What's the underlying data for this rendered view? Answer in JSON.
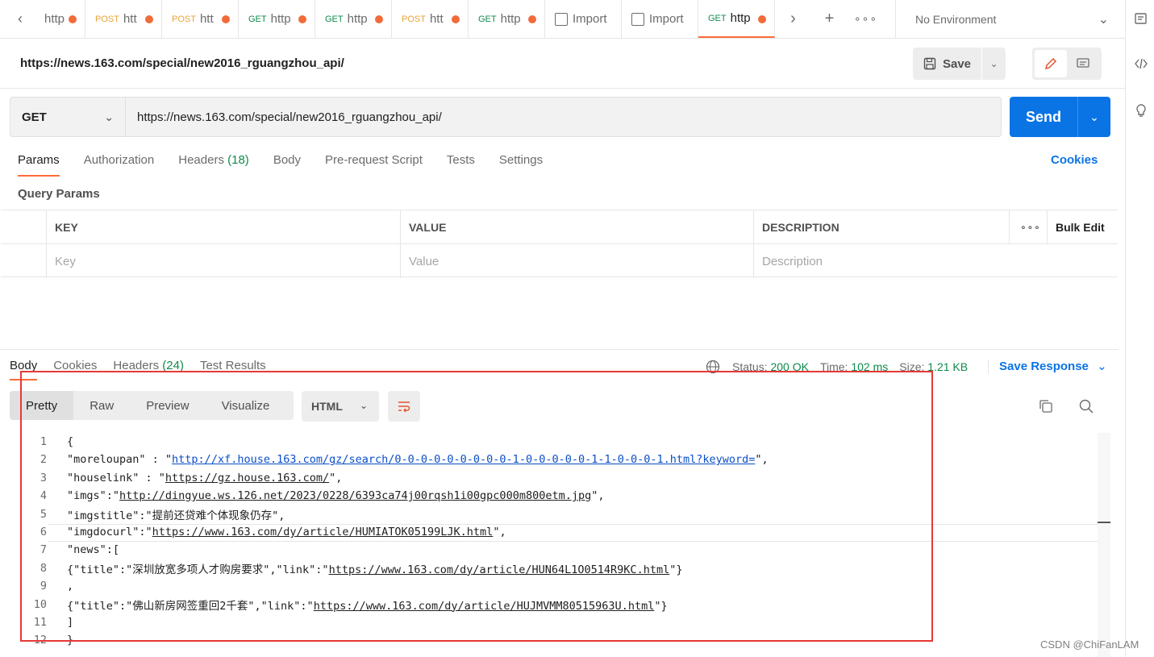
{
  "tabs": [
    {
      "method": "",
      "label": "http"
    },
    {
      "method": "POST",
      "label": "htt"
    },
    {
      "method": "POST",
      "label": "htt"
    },
    {
      "method": "GET",
      "label": "http"
    },
    {
      "method": "GET",
      "label": "http"
    },
    {
      "method": "POST",
      "label": "htt"
    },
    {
      "method": "GET",
      "label": "http"
    },
    {
      "method": "",
      "label": "Import"
    },
    {
      "method": "",
      "label": "Import"
    },
    {
      "method": "GET",
      "label": "http"
    }
  ],
  "environment": {
    "label": "No Environment"
  },
  "request": {
    "title": "https://news.163.com/special/new2016_rguangzhou_api/",
    "method": "GET",
    "url": "https://news.163.com/special/new2016_rguangzhou_api/",
    "save_label": "Save",
    "send_label": "Send"
  },
  "request_tabs": {
    "params": "Params",
    "authorization": "Authorization",
    "headers": "Headers",
    "headers_count": "(18)",
    "body": "Body",
    "prerequest": "Pre-request Script",
    "tests": "Tests",
    "settings": "Settings",
    "cookies": "Cookies"
  },
  "query_params": {
    "title": "Query Params",
    "columns": {
      "key": "KEY",
      "value": "VALUE",
      "description": "DESCRIPTION",
      "bulk_edit": "Bulk Edit"
    },
    "placeholders": {
      "key": "Key",
      "value": "Value",
      "description": "Description"
    }
  },
  "response": {
    "tabs": {
      "body": "Body",
      "cookies": "Cookies",
      "headers": "Headers",
      "headers_count": "(24)",
      "tests": "Test Results"
    },
    "status_label": "Status:",
    "status_value": "200 OK",
    "time_label": "Time:",
    "time_value": "102 ms",
    "size_label": "Size:",
    "size_value": "1.21 KB",
    "save_response": "Save Response",
    "views": {
      "pretty": "Pretty",
      "raw": "Raw",
      "preview": "Preview",
      "visualize": "Visualize"
    },
    "format": "HTML"
  },
  "code_lines": [
    {
      "n": "1",
      "pre": "{",
      "url": "",
      "post": ""
    },
    {
      "n": "2",
      "pre": "\"moreloupan\" : \"",
      "url": "http://xf.house.163.com/gz/search/0-0-0-0-0-0-0-0-0-1-0-0-0-0-0-1-1-0-0-0-1.html?keyword=",
      "post": "\",",
      "blue": true
    },
    {
      "n": "3",
      "pre": "\"houselink\" : \"",
      "url": "https://gz.house.163.com/",
      "post": "\","
    },
    {
      "n": "4",
      "pre": "\"imgs\":\"",
      "url": "http://dingyue.ws.126.net/2023/0228/6393ca74j00rqsh1i00gpc000m800etm.jpg",
      "post": "\","
    },
    {
      "n": "5",
      "pre": "\"imgstitle\":\"提前还贷难个体现象仍存\",",
      "url": "",
      "post": ""
    },
    {
      "n": "6",
      "pre": "\"imgdocurl\":\"",
      "url": "https://www.163.com/dy/article/HUMIATOK05199LJK.html",
      "post": "\","
    },
    {
      "n": "7",
      "pre": "\"news\":[",
      "url": "",
      "post": ""
    },
    {
      "n": "8",
      "pre": "{\"title\":\"深圳放宽多项人才购房要求\",\"link\":\"",
      "url": "https://www.163.com/dy/article/HUN64L1O0514R9KC.html",
      "post": "\"}"
    },
    {
      "n": "9",
      "pre": ",",
      "url": "",
      "post": ""
    },
    {
      "n": "10",
      "pre": "{\"title\":\"佛山新房网签重回2千套\",\"link\":\"",
      "url": "https://www.163.com/dy/article/HUJMVMM80515963U.html",
      "post": "\"}"
    },
    {
      "n": "11",
      "pre": "]",
      "url": "",
      "post": ""
    },
    {
      "n": "12",
      "pre": "}",
      "url": "",
      "post": ""
    }
  ],
  "watermark": "CSDN @ChiFanLAM",
  "colors": {
    "accent": "#ff6c37",
    "primary": "#0b74e5",
    "get": "#0f8a4c",
    "post": "#e8a33a",
    "highlight_box": "#e53935"
  }
}
